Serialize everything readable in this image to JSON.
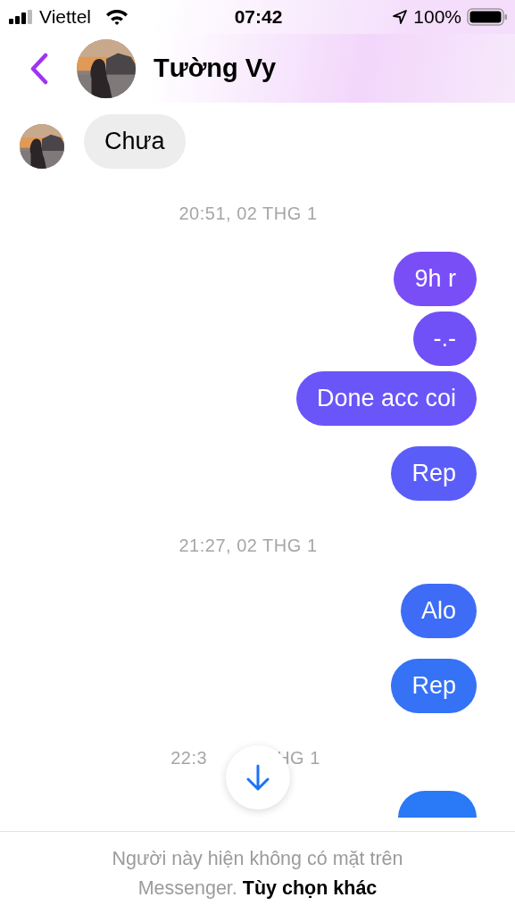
{
  "status_bar": {
    "carrier": "Viettel",
    "time": "07:42",
    "battery": "100%"
  },
  "header": {
    "title": "Tường Vy"
  },
  "messages": [
    {
      "kind": "incoming",
      "text": "Chưa"
    },
    {
      "kind": "timestamp",
      "text": "20:51, 02 THG 1"
    },
    {
      "kind": "outgoing",
      "text": "9h r",
      "color": "#7a4ef6"
    },
    {
      "kind": "outgoing",
      "text": "-.-",
      "color": "#7050f7"
    },
    {
      "kind": "outgoing",
      "text": "Done acc coi",
      "color": "#6a55f8"
    },
    {
      "kind": "outgoing",
      "text": "Rep",
      "color": "#5b5df8"
    },
    {
      "kind": "timestamp",
      "text": "21:27, 02 THG 1"
    },
    {
      "kind": "outgoing",
      "text": "Alo",
      "color": "#3e6cf6"
    },
    {
      "kind": "outgoing",
      "text": "Rep",
      "color": "#3572f5"
    },
    {
      "kind": "timestamp_partial",
      "parts": [
        "22:3",
        "HG 1"
      ]
    },
    {
      "kind": "outgoing_cut",
      "color": "#2a79f6"
    }
  ],
  "footer": {
    "notice": "Người này hiện không có mặt trên Messenger.",
    "link": "Tùy chọn khác"
  }
}
